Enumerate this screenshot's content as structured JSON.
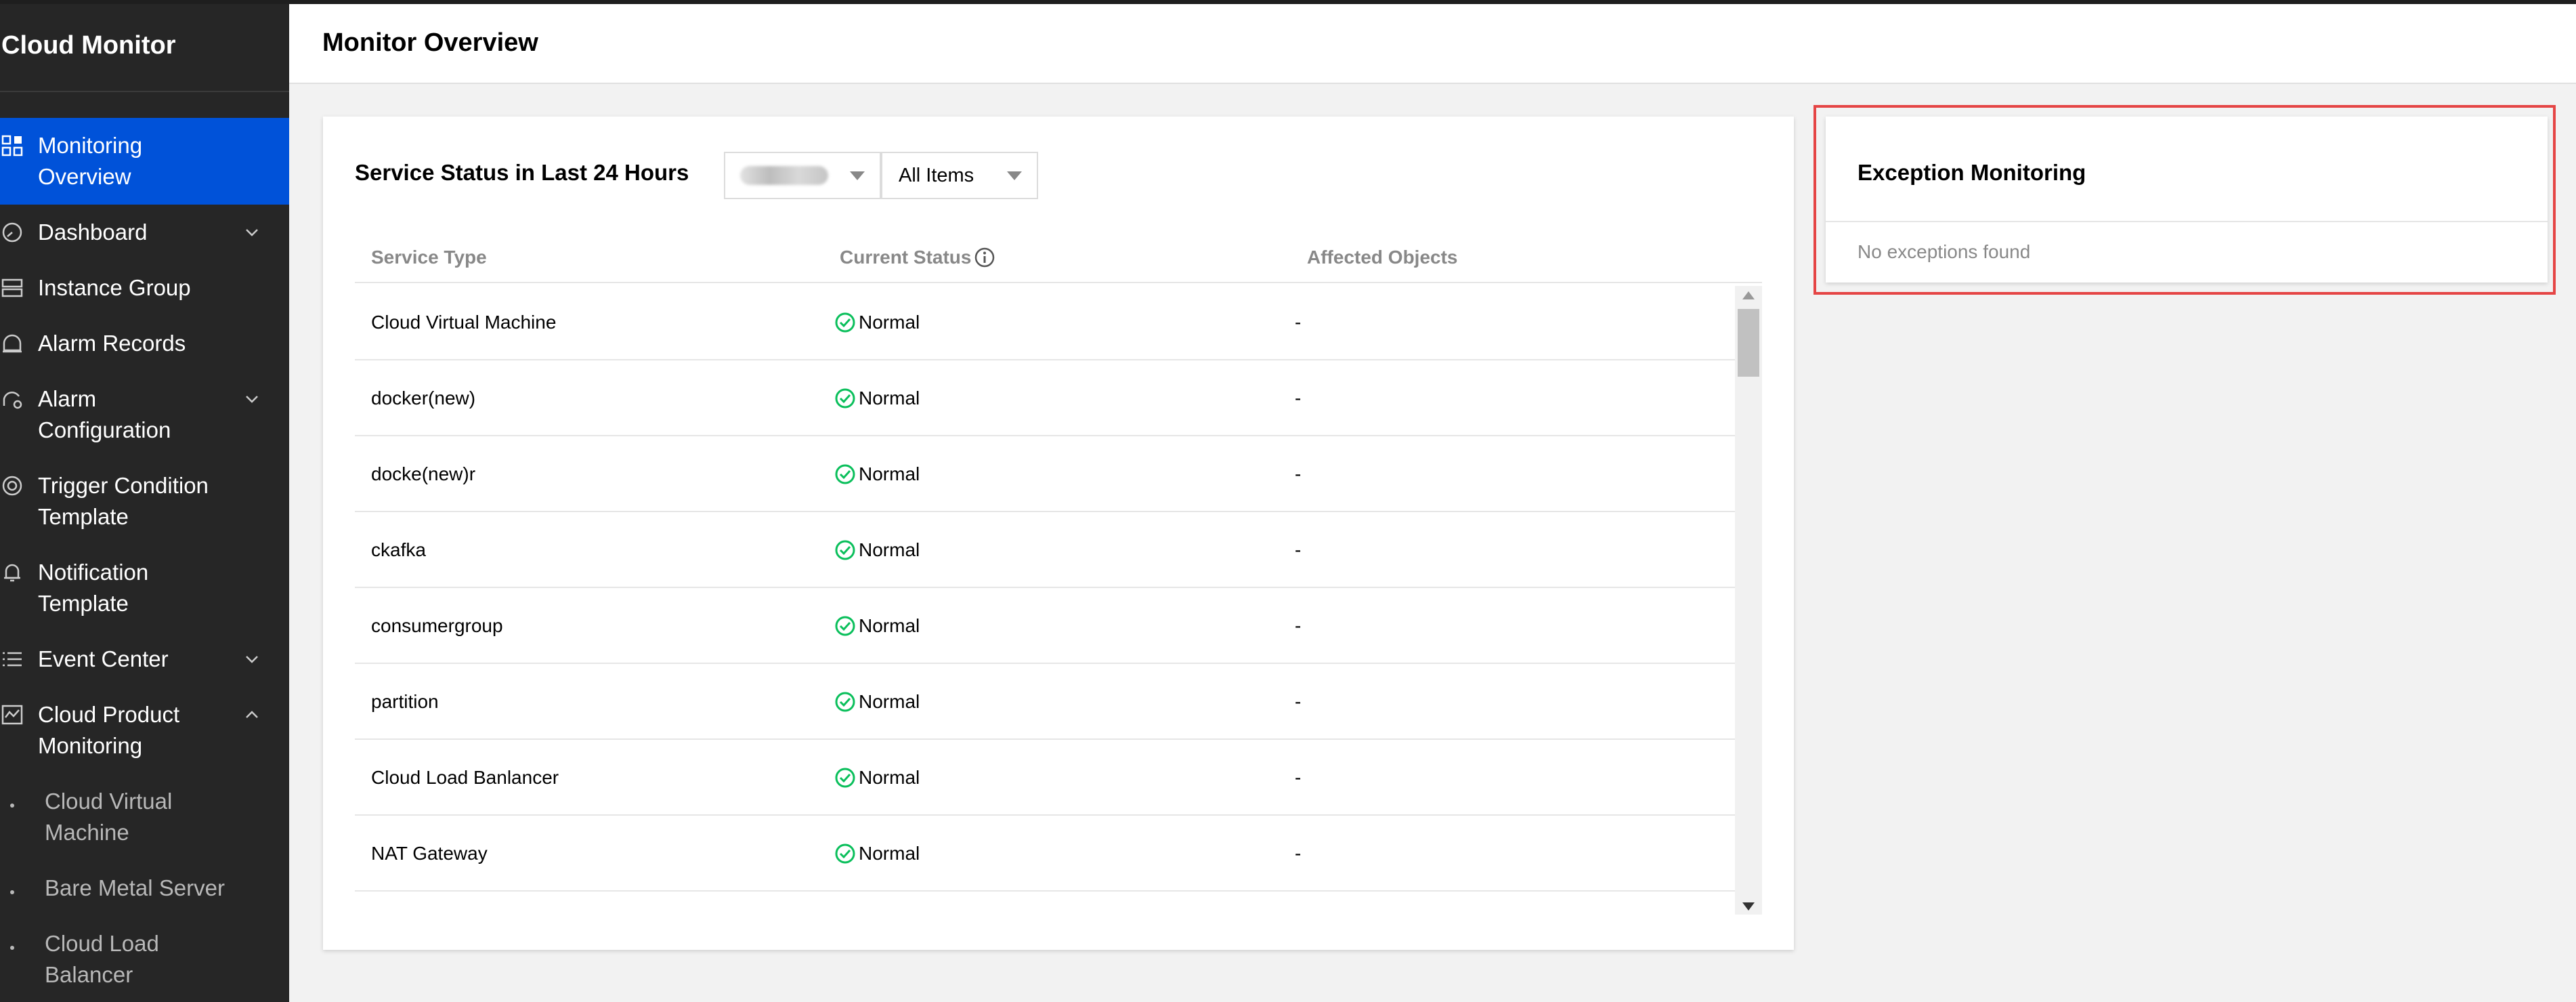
{
  "app": {
    "title": "Cloud Monitor"
  },
  "sidebar": {
    "items": [
      {
        "label": "Monitoring Overview",
        "icon": "grid-icon",
        "active": true,
        "chevron": ""
      },
      {
        "label": "Dashboard",
        "icon": "dashboard-gauge-icon",
        "active": false,
        "chevron": "down"
      },
      {
        "label": "Instance Group",
        "icon": "server-group-icon",
        "active": false,
        "chevron": ""
      },
      {
        "label": "Alarm Records",
        "icon": "alarm-bell-icon",
        "active": false,
        "chevron": ""
      },
      {
        "label": "Alarm Configuration",
        "icon": "alarm-settings-icon",
        "active": false,
        "chevron": "down"
      },
      {
        "label": "Trigger Condition Template",
        "icon": "target-icon",
        "active": false,
        "chevron": ""
      },
      {
        "label": "Notification Template",
        "icon": "notification-bell-icon",
        "active": false,
        "chevron": ""
      },
      {
        "label": "Event Center",
        "icon": "list-icon",
        "active": false,
        "chevron": "down"
      },
      {
        "label": "Cloud Product Monitoring",
        "icon": "chart-icon",
        "active": false,
        "chevron": "up"
      }
    ],
    "subitems": [
      {
        "label": "Cloud Virtual Machine"
      },
      {
        "label": "Bare Metal Server"
      },
      {
        "label": "Cloud Load Balancer"
      }
    ]
  },
  "header": {
    "title": "Monitor Overview"
  },
  "service_status": {
    "title": "Service Status in Last 24 Hours",
    "region_select": {
      "value": ""
    },
    "items_select": {
      "value": "All Items"
    },
    "columns": [
      "Service Type",
      "Current Status",
      "Affected Objects"
    ],
    "rows": [
      {
        "type": "Cloud Virtual Machine",
        "status": "Normal",
        "affected": "-"
      },
      {
        "type": "docker(new)",
        "status": "Normal",
        "affected": "-"
      },
      {
        "type": "docke(new)r",
        "status": "Normal",
        "affected": "-"
      },
      {
        "type": "ckafka",
        "status": "Normal",
        "affected": "-"
      },
      {
        "type": "consumergroup",
        "status": "Normal",
        "affected": "-"
      },
      {
        "type": "partition",
        "status": "Normal",
        "affected": "-"
      },
      {
        "type": "Cloud Load Banlancer",
        "status": "Normal",
        "affected": "-"
      },
      {
        "type": "NAT Gateway",
        "status": "Normal",
        "affected": "-"
      }
    ]
  },
  "exception_monitoring": {
    "title": "Exception Monitoring",
    "message": "No exceptions found"
  },
  "colors": {
    "sidebar_bg": "#262626",
    "active_bg": "#0052d9",
    "status_normal": "#0abf5b",
    "highlight_outline": "#e54545"
  }
}
